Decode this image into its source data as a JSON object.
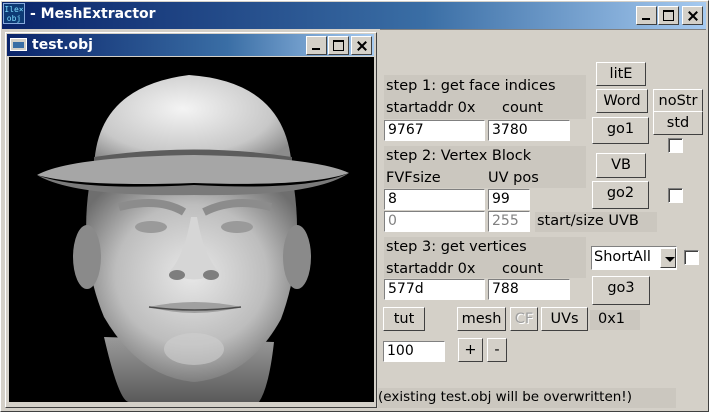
{
  "app": {
    "icon_text": "Ile×\nobj",
    "title": "- MeshExtractor"
  },
  "mesh_window": {
    "title": "test.obj"
  },
  "step1": {
    "heading": "step 1: get face indices",
    "startaddr_label": "startaddr 0x",
    "count_label": "count",
    "startaddr_value": "9767",
    "count_value": "3780"
  },
  "step2": {
    "heading": "step 2: Vertex Block",
    "fvfsize_label": "FVFsize",
    "uvpos_label": "UV pos",
    "fvfsize_value": "8",
    "uvpos_value": "99",
    "uvb_start_value": "0",
    "uvb_size_value": "255",
    "uvb_label": "start/size UVB"
  },
  "step3": {
    "heading": "step 3: get vertices",
    "startaddr_label": "startaddr 0x",
    "count_label": "count",
    "startaddr_value": "577d",
    "count_value": "788",
    "format_selected": "ShortAll"
  },
  "buttons": {
    "lite": "litE",
    "word": "Word",
    "nostr": "noStr",
    "std": "std",
    "go1": "go1",
    "vb": "VB",
    "go2": "go2",
    "go3": "go3",
    "tut": "tut",
    "mesh": "mesh",
    "cf": "CF",
    "uvs": "UVs",
    "plus": "+",
    "minus": "-"
  },
  "misc": {
    "ratio": "0x1",
    "scale_value": "100",
    "status": "(existing test.obj will be overwritten!)"
  }
}
